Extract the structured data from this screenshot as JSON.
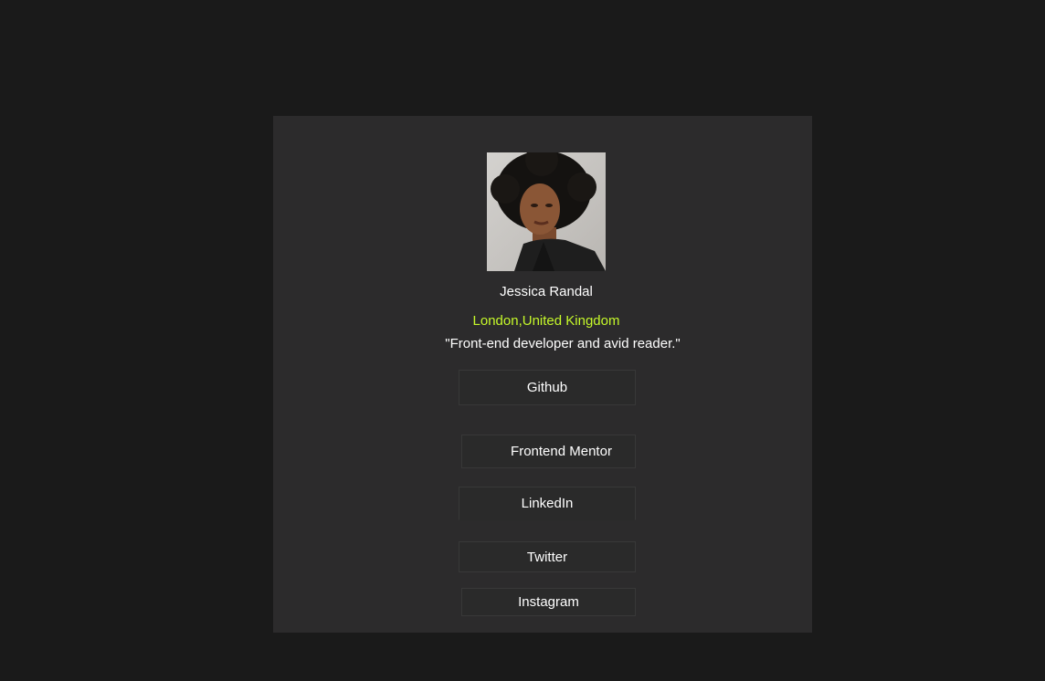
{
  "profile": {
    "name": "Jessica Randal",
    "location": "London,United Kingdom",
    "bio": "\"Front-end developer and avid reader.\""
  },
  "links": {
    "github": "Github",
    "frontend_mentor": "Frontend Mentor",
    "linkedin": "LinkedIn",
    "twitter": "Twitter",
    "instagram": "Instagram"
  },
  "colors": {
    "page_background": "#1a1a1a",
    "card_background": "#2c2b2c",
    "accent": "#c5f82a",
    "text": "#ffffff"
  }
}
